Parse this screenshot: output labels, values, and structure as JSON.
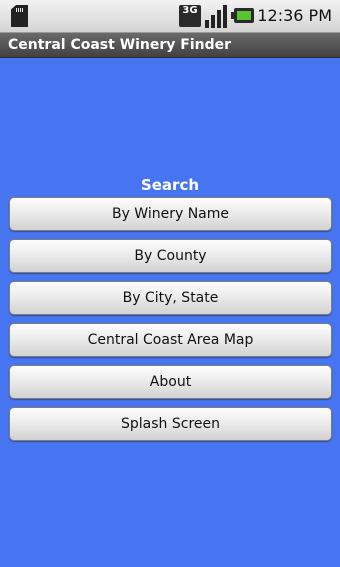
{
  "status_bar": {
    "network_label": "3G",
    "time": "12:36 PM",
    "icons": [
      "sd-card-icon",
      "3g-network-icon",
      "signal-strength-icon",
      "battery-icon"
    ]
  },
  "app": {
    "title": "Central Coast Winery Finder"
  },
  "search": {
    "heading": "Search",
    "buttons": [
      {
        "label": "By Winery Name"
      },
      {
        "label": "By County"
      },
      {
        "label": "By City, State"
      },
      {
        "label": "Central Coast Area Map"
      },
      {
        "label": "About"
      },
      {
        "label": "Splash Screen"
      }
    ]
  },
  "colors": {
    "background": "#4774f0",
    "title_bar": "#555555",
    "battery_level": "#58c430"
  }
}
